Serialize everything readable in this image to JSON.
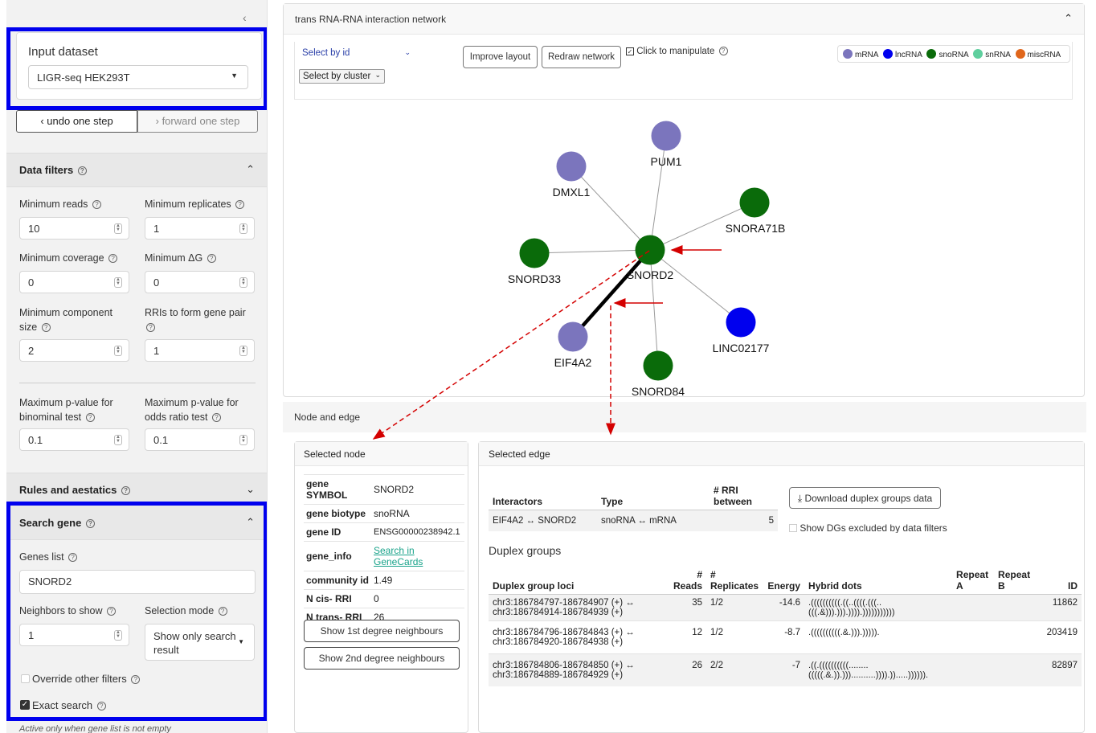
{
  "sidebar": {
    "collapse_icon": "chevron-left-icon",
    "input_dataset": {
      "label": "Input dataset",
      "value": "LIGR-seq HEK293T"
    },
    "undo_label": "undo one step",
    "forward_label": "forward one step",
    "data_filters": {
      "title": "Data filters",
      "min_reads": {
        "label": "Minimum reads",
        "value": "10"
      },
      "min_replicates": {
        "label": "Minimum replicates",
        "value": "1"
      },
      "min_coverage": {
        "label": "Minimum coverage",
        "value": "0"
      },
      "min_dg": {
        "label": "Minimum ΔG",
        "value": "0"
      },
      "min_component": {
        "label": "Minimum component size",
        "value": "2"
      },
      "rris_pair": {
        "label": "RRIs to form gene pair",
        "value": "1"
      },
      "max_p_binomial": {
        "label": "Maximum p-value for binominal test",
        "value": "0.1"
      },
      "max_p_odds": {
        "label": "Maximum p-value for odds ratio test",
        "value": "0.1"
      }
    },
    "rules": {
      "title": "Rules and aestatics"
    },
    "search_gene": {
      "title": "Search gene",
      "genes_list_label": "Genes list",
      "genes_list_value": "SNORD2",
      "neighbors_label": "Neighbors to show",
      "neighbors_value": "1",
      "selection_mode_label": "Selection mode",
      "selection_mode_value": "Show only search result",
      "override_label": "Override other filters",
      "override_checked": false,
      "exact_label": "Exact search",
      "exact_checked": true,
      "note": "Active only when gene list is not empty"
    }
  },
  "network": {
    "title": "trans RNA-RNA interaction network",
    "select_id": "Select by id",
    "select_cluster": "Select by cluster",
    "improve_label": "Improve layout",
    "redraw_label": "Redraw network",
    "manipulate_label": "Click to manipulate",
    "manipulate_checked": true,
    "legend": [
      {
        "name": "mRNA",
        "color": "#7b75bd"
      },
      {
        "name": "lncRNA",
        "color": "#0000ee"
      },
      {
        "name": "snoRNA",
        "color": "#0a6b0a"
      },
      {
        "name": "snRNA",
        "color": "#5fcf9e"
      },
      {
        "name": "miscRNA",
        "color": "#e0661b"
      }
    ],
    "nodes": [
      {
        "id": "SNORD2",
        "type": "snoRNA"
      },
      {
        "id": "PUM1",
        "type": "mRNA"
      },
      {
        "id": "DMXL1",
        "type": "mRNA"
      },
      {
        "id": "SNORA71B",
        "type": "snoRNA"
      },
      {
        "id": "SNORD33",
        "type": "snoRNA"
      },
      {
        "id": "LINC02177",
        "type": "lncRNA"
      },
      {
        "id": "EIF4A2",
        "type": "mRNA"
      },
      {
        "id": "SNORD84",
        "type": "snoRNA"
      }
    ]
  },
  "node_edge": {
    "title": "Node and edge",
    "selected_node": {
      "title": "Selected node",
      "rows": [
        {
          "k": "gene SYMBOL",
          "v": "SNORD2"
        },
        {
          "k": "gene biotype",
          "v": "snoRNA"
        },
        {
          "k": "gene ID",
          "v": "ENSG00000238942.1"
        },
        {
          "k": "gene_info",
          "v": "Search in GeneCards"
        },
        {
          "k": "community id",
          "v": "1.49"
        },
        {
          "k": "N cis- RRI",
          "v": "0"
        },
        {
          "k": "N trans- RRI",
          "v": "26"
        }
      ],
      "btn1": "Show 1st degree neighbours",
      "btn2": "Show 2nd degree neighbours"
    },
    "selected_edge": {
      "title": "Selected edge",
      "head": {
        "interactors": "Interactors",
        "type": "Type",
        "rri": "# RRI between"
      },
      "row": {
        "interactors": "EIF4A2 ↔ SNORD2",
        "type": "snoRNA ↔ mRNA",
        "rri": "5"
      },
      "download_label": "Download duplex groups data",
      "show_dgs_label": "Show DGs excluded by data filters",
      "duplex_title": "Duplex groups",
      "dg_head": {
        "loci": "Duplex group loci",
        "reads": "# Reads",
        "replicates": "# Replicates",
        "energy": "Energy",
        "dots": "Hybrid dots",
        "repA": "Repeat A",
        "repB": "Repeat B",
        "id": "ID"
      },
      "dg_rows": [
        {
          "loci1": "chr3:186784797-186784907 (+) ↔",
          "loci2": "chr3:186784914-186784939 (+)",
          "reads": "35",
          "replicates": "1/2",
          "energy": "-14.6",
          "dots1": ".((((((((((.((..((((.(((..",
          "dots2": "(((.&))).))).)))).)))))))))))",
          "id": "11862"
        },
        {
          "loci1": "chr3:186784796-186784843 (+) ↔",
          "loci2": "chr3:186784920-186784938 (+)",
          "reads": "12",
          "replicates": "1/2",
          "energy": "-8.7",
          "dots1": ".((((((((((.&.))).))))).",
          "dots2": "",
          "id": "203419"
        },
        {
          "loci1": "chr3:186784806-186784850 (+) ↔",
          "loci2": "chr3:186784889-186784929 (+)",
          "reads": "26",
          "replicates": "2/2",
          "energy": "-7",
          "dots1": ".((.((((((((((........",
          "dots2": "(((((.&.)).)))..........)))).)).....)))))).",
          "id": "82897"
        }
      ]
    }
  }
}
